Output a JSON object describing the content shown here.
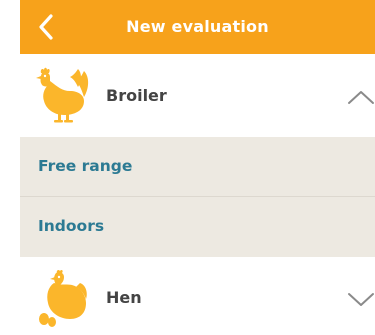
{
  "header": {
    "title": "New evaluation",
    "back_icon": "chevron-left-icon",
    "color": "#f7a21b"
  },
  "categories": [
    {
      "label": "Broiler",
      "icon": "rooster-icon",
      "state": "expanded",
      "chevron": "chevron-up-icon",
      "subitems": [
        {
          "label": "Free range"
        },
        {
          "label": "Indoors"
        }
      ]
    },
    {
      "label": "Hen",
      "icon": "hen-icon",
      "state": "collapsed",
      "chevron": "chevron-down-icon"
    }
  ],
  "colors": {
    "accent": "#f7a21b",
    "icon_fill": "#fbb62b",
    "submenu_bg": "#ede9e1",
    "submenu_text": "#2c7a93",
    "label_text": "#444444"
  }
}
